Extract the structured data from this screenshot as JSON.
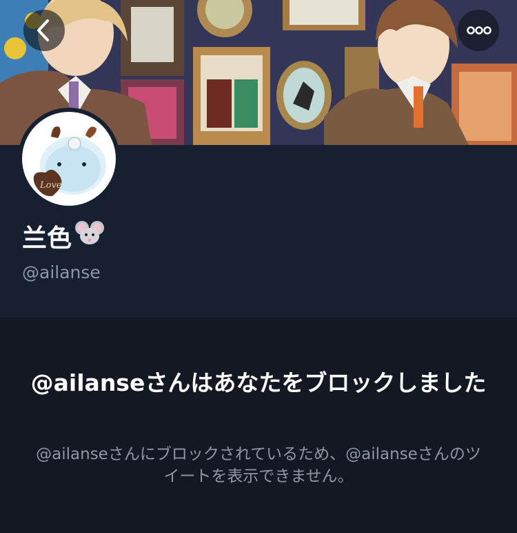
{
  "header": {
    "back_icon": "chevron-left-icon",
    "more_icon": "more-horizontal-icon"
  },
  "profile": {
    "display_name": "兰色",
    "name_emoji": "mouse-face-icon",
    "avatar_badge_text": "Love",
    "handle": "@ailanse"
  },
  "blocked": {
    "title": "@ailanseさんはあなたをブロックしました",
    "message": "@ailanseさんにブロックされているため、@ailanseさんのツイートを表示できません。"
  },
  "colors": {
    "page_background": "#141823",
    "profile_background": "#172030",
    "primary_text": "#ffffff",
    "secondary_text": "#8b98a5"
  }
}
